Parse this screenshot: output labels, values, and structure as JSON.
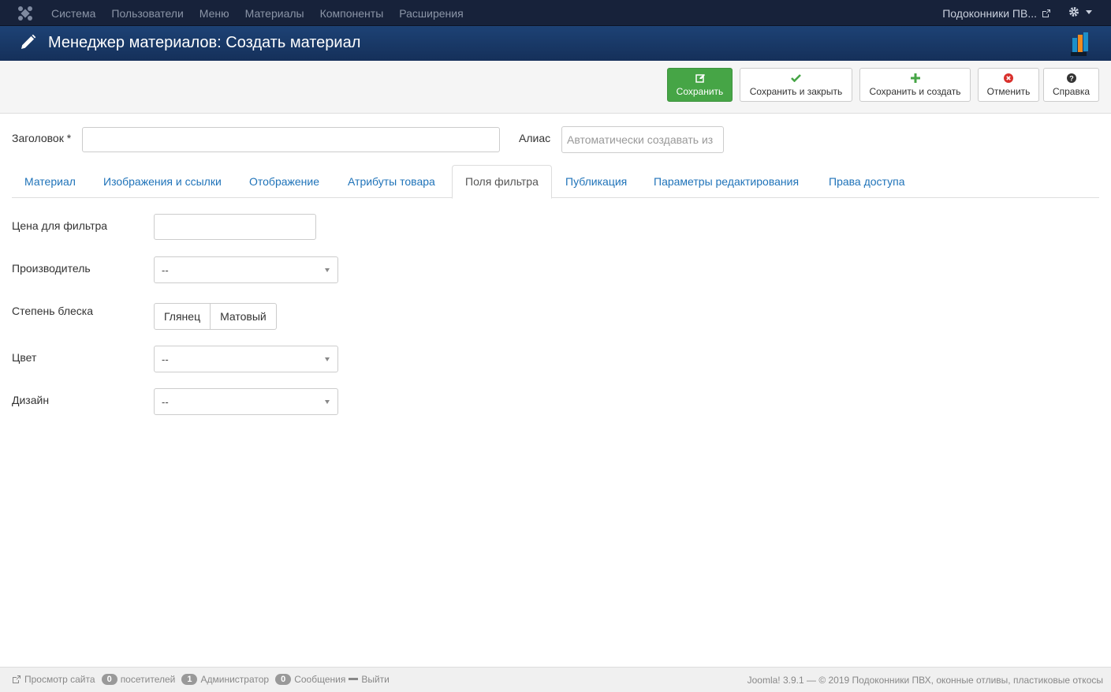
{
  "topnav": {
    "menu": [
      "Система",
      "Пользователи",
      "Меню",
      "Материалы",
      "Компоненты",
      "Расширения"
    ],
    "site_name": "Подоконники ПВ...",
    "icons": {
      "logo": "joomla-icon",
      "external": "external-link-icon",
      "settings": "gear-icon"
    }
  },
  "title": "Менеджер материалов: Создать материал",
  "toolbar": {
    "save": "Сохранить",
    "save_close": "Сохранить и закрыть",
    "save_new": "Сохранить и создать",
    "cancel": "Отменить",
    "help": "Справка"
  },
  "form": {
    "title_label": "Заголовок *",
    "title_value": "",
    "alias_label": "Алиас",
    "alias_placeholder": "Автоматически создавать из"
  },
  "tabs": [
    "Материал",
    "Изображения и ссылки",
    "Отображение",
    "Атрибуты товара",
    "Поля фильтра",
    "Публикация",
    "Параметры редактирования",
    "Права доступа"
  ],
  "active_tab": "Поля фильтра",
  "fields": {
    "price_label": "Цена для фильтра",
    "price_value": "",
    "manufacturer_label": "Производитель",
    "manufacturer_value": "--",
    "gloss_label": "Степень блеска",
    "gloss_options": [
      "Глянец",
      "Матовый"
    ],
    "color_label": "Цвет",
    "color_value": "--",
    "design_label": "Дизайн",
    "design_value": "--"
  },
  "footer": {
    "view_site": "Просмотр сайта",
    "visitors_count": "0",
    "visitors_label": "посетителей",
    "admins_count": "1",
    "admins_label": "Администратор",
    "messages_count": "0",
    "messages_label": "Сообщения",
    "logout": "Выйти",
    "copyright": "Joomla! 3.9.1 — © 2019 Подоконники ПВХ, оконные отливы, пластиковые откосы"
  },
  "colors": {
    "nav_bg": "#17223a",
    "title_bg": "#1a3867",
    "save_green": "#46a546",
    "link_blue": "#1f73b9"
  }
}
